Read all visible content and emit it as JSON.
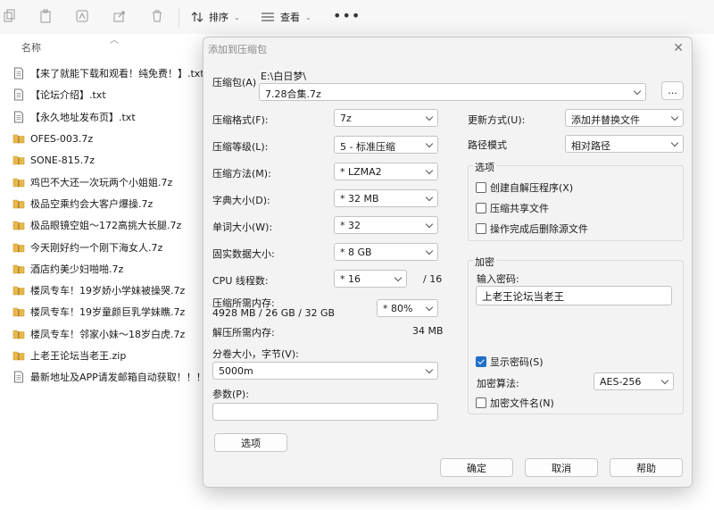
{
  "toolbar": {
    "sort_label": "排序",
    "view_label": "查看",
    "more_label": "•••"
  },
  "file_list": {
    "column_header": "名称",
    "items": [
      {
        "name": "【来了就能下载和观看！纯免费！】.txt",
        "type": "txt"
      },
      {
        "name": "【论坛介绍】.txt",
        "type": "txt"
      },
      {
        "name": "【永久地址发布页】.txt",
        "type": "txt"
      },
      {
        "name": "OFES-003.7z",
        "type": "archive"
      },
      {
        "name": "SONE-815.7z",
        "type": "archive"
      },
      {
        "name": "鸡巴不大还一次玩两个小姐姐.7z",
        "type": "archive"
      },
      {
        "name": "极品空乘约会大客户爆操.7z",
        "type": "archive"
      },
      {
        "name": "极品眼镜空姐～172高挑大长腿.7z",
        "type": "archive"
      },
      {
        "name": "今天刚好约一个刚下海女人.7z",
        "type": "archive"
      },
      {
        "name": "酒店约美少妇啪啪.7z",
        "type": "archive"
      },
      {
        "name": "楼凤专车！19岁娇小学妹被操哭.7z",
        "type": "archive"
      },
      {
        "name": "楼凤专车！19岁童颜巨乳学妹瞧.7z",
        "type": "archive"
      },
      {
        "name": "楼凤专车！邻家小妹～18岁白虎.7z",
        "type": "archive"
      },
      {
        "name": "上老王论坛当老王.zip",
        "type": "archive"
      },
      {
        "name": "最新地址及APP请发邮箱自动获取！！！...",
        "type": "txt"
      }
    ]
  },
  "dialog": {
    "title": "添加到压缩包",
    "close": "✕",
    "archive": {
      "label": "压缩包(A)",
      "path": "E:\\白日梦\\",
      "name": "7.28合集.7z",
      "browse": "..."
    },
    "left": {
      "format": {
        "label": "压缩格式(F):",
        "value": "7z"
      },
      "level": {
        "label": "压缩等级(L):",
        "value": "5 - 标准压缩"
      },
      "method": {
        "label": "压缩方法(M):",
        "value": "* LZMA2"
      },
      "dict": {
        "label": "字典大小(D):",
        "value": "* 32 MB"
      },
      "word": {
        "label": "单词大小(W):",
        "value": "* 32"
      },
      "solid": {
        "label": "固实数据大小:",
        "value": "* 8 GB"
      },
      "threads": {
        "label": "CPU 线程数:",
        "value": "* 16",
        "total": "/ 16"
      },
      "mem_compress": {
        "label": "压缩所需内存:",
        "detail": "4928 MB / 26 GB / 32 GB",
        "value": "* 80%"
      },
      "mem_decompress": {
        "label": "解压所需内存:",
        "value": "34 MB"
      },
      "volume": {
        "label": "分卷大小，字节(V):",
        "value": "5000m"
      },
      "params": {
        "label": "参数(P):",
        "value": ""
      },
      "options_button": "选项"
    },
    "right": {
      "update": {
        "label": "更新方式(U):",
        "value": "添加并替换文件"
      },
      "path_mode": {
        "label": "路径模式",
        "value": "相对路径"
      },
      "options_group": {
        "title": "选项",
        "sfx": {
          "label": "创建自解压程序(X)",
          "checked": false
        },
        "shared": {
          "label": "压缩共享文件",
          "checked": false
        },
        "delete": {
          "label": "操作完成后删除源文件",
          "checked": false
        }
      },
      "encryption": {
        "title": "加密",
        "password_label": "输入密码:",
        "password_value": "上老王论坛当老王",
        "show_password": {
          "label": "显示密码(S)",
          "checked": true
        },
        "method_label": "加密算法:",
        "method_value": "AES-256",
        "encrypt_names": {
          "label": "加密文件名(N)",
          "checked": false
        }
      }
    },
    "buttons": {
      "ok": "确定",
      "cancel": "取消",
      "help": "帮助"
    }
  }
}
